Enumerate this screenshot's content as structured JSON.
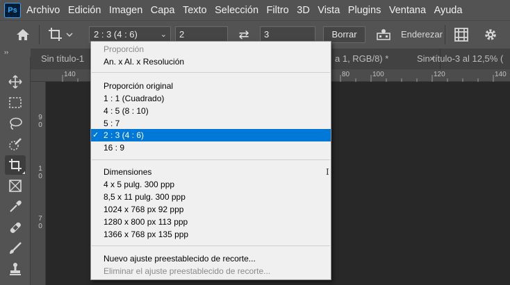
{
  "app": {
    "logo": "Ps"
  },
  "menu": [
    "Archivo",
    "Edición",
    "Imagen",
    "Capa",
    "Texto",
    "Selección",
    "Filtro",
    "3D",
    "Vista",
    "Plugins",
    "Ventana",
    "Ayuda"
  ],
  "options": {
    "ratio_value": "2 : 3 (4 : 6)",
    "width_value": "2",
    "height_value": "3",
    "clear_label": "Borrar",
    "straighten_label": "Enderezar"
  },
  "tabs": [
    {
      "label": "Sin título-1",
      "close": ""
    },
    {
      "label": "a 1, RGB/8) *",
      "close": "×"
    },
    {
      "label": "Sin título-3 al 12,5% (",
      "close": ""
    }
  ],
  "toolbar_collapse": "››",
  "ruler": {
    "top": [
      "140",
      "20",
      "40",
      "60",
      "80",
      "100",
      "120",
      "140"
    ],
    "left": [
      [
        "9",
        "0"
      ],
      [
        "1",
        "0"
      ],
      [
        "7",
        "0"
      ]
    ]
  },
  "dropdown": {
    "items": [
      {
        "label": "Proporción",
        "type": "disabled"
      },
      {
        "label": "An. x Al. x Resolución",
        "type": "normal"
      },
      {
        "type": "separator"
      },
      {
        "label": "Proporción original",
        "type": "normal"
      },
      {
        "label": "1 : 1 (Cuadrado)",
        "type": "normal"
      },
      {
        "label": "4 : 5 (8 : 10)",
        "type": "normal"
      },
      {
        "label": "5 : 7",
        "type": "normal"
      },
      {
        "label": "2 : 3 (4 : 6)",
        "type": "selected",
        "check": "✓"
      },
      {
        "label": "16 : 9",
        "type": "normal"
      },
      {
        "type": "separator"
      },
      {
        "label": "Dimensiones",
        "type": "normal"
      },
      {
        "label": "4 x 5 pulg.  300 ppp",
        "type": "normal"
      },
      {
        "label": "8,5 x 11 pulg.  300 ppp",
        "type": "normal"
      },
      {
        "label": "1024 x 768 px  92 ppp",
        "type": "normal"
      },
      {
        "label": "1280 x 800 px  113 ppp",
        "type": "normal"
      },
      {
        "label": "1366 x 768 px  135 ppp",
        "type": "normal"
      },
      {
        "type": "separator"
      },
      {
        "label": "Nuevo ajuste preestablecido de recorte...",
        "type": "normal"
      },
      {
        "label": "Eliminar el ajuste preestablecido de recorte...",
        "type": "disabled"
      }
    ],
    "cursor_glyph": "I"
  },
  "colors": {
    "selection": "#0078d7",
    "panel": "#535353",
    "canvas": "#282828"
  }
}
